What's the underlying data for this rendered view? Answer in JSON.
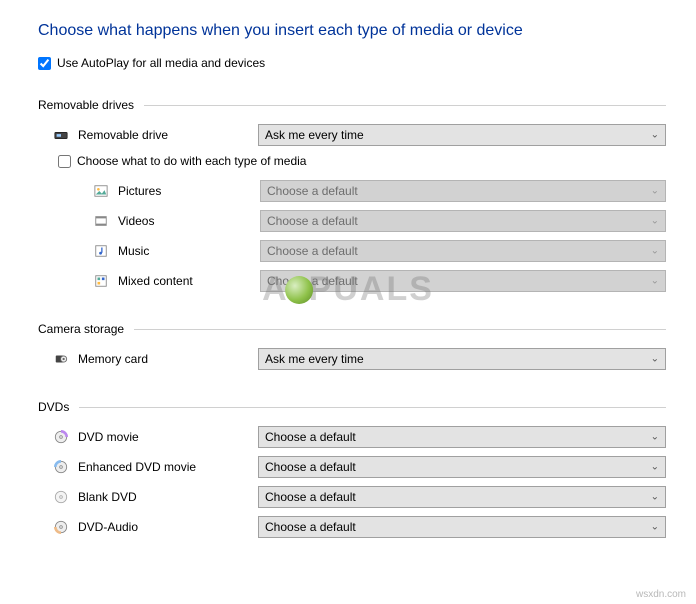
{
  "title": "Choose what happens when you insert each type of media or device",
  "useAutoplayLabel": "Use AutoPlay for all media and devices",
  "useAutoplayChecked": true,
  "sections": {
    "removable": {
      "legend": "Removable drives",
      "driveLabel": "Removable drive",
      "driveValue": "Ask me every time",
      "subCheckLabel": "Choose what to do with each type of media",
      "subCheckChecked": false,
      "items": {
        "pictures": {
          "label": "Pictures",
          "value": "Choose a default"
        },
        "videos": {
          "label": "Videos",
          "value": "Choose a default"
        },
        "music": {
          "label": "Music",
          "value": "Choose a default"
        },
        "mixed": {
          "label": "Mixed content",
          "value": "Choose a default"
        }
      }
    },
    "camera": {
      "legend": "Camera storage",
      "memoryLabel": "Memory card",
      "memoryValue": "Ask me every time"
    },
    "dvds": {
      "legend": "DVDs",
      "items": {
        "movie": {
          "label": "DVD movie",
          "value": "Choose a default"
        },
        "enhanced": {
          "label": "Enhanced DVD movie",
          "value": "Choose a default"
        },
        "blank": {
          "label": "Blank DVD",
          "value": "Choose a default"
        },
        "audio": {
          "label": "DVD-Audio",
          "value": "Choose a default"
        }
      }
    }
  },
  "watermark": "PUALS",
  "footer": "wsxdn.com"
}
